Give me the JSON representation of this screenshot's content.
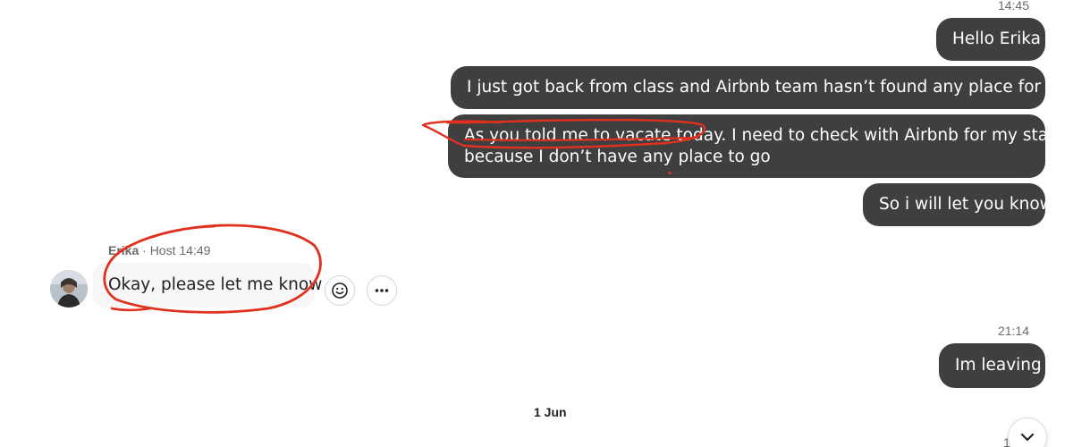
{
  "thread": {
    "messages_block1": {
      "time": "14:45",
      "m1": "Hello Erika",
      "m2": "I just got back from class and Airbnb team hasn’t found any place for me yet",
      "m3_line1": "As you told me to vacate today. I need to check with Airbnb for my stay",
      "m3_line2": "because I don’t have any place to go",
      "m4": "So i will let you know"
    },
    "host_message": {
      "sender_name": "Erika",
      "sender_role": "· Host",
      "time": "14:49",
      "text": "Okay, please let me know"
    },
    "messages_block2": {
      "time": "21:14",
      "m1": "Im leaving"
    },
    "date_separator": "1 Jun",
    "partial_time": "1"
  },
  "colors": {
    "outgoing_bubble": "#3f3f3f",
    "incoming_bubble": "#f7f7f7",
    "annotation_red": "#e0311f"
  },
  "icons": {
    "react": "smiley-icon",
    "more": "more-dots-icon",
    "scroll": "chevron-down-icon"
  }
}
